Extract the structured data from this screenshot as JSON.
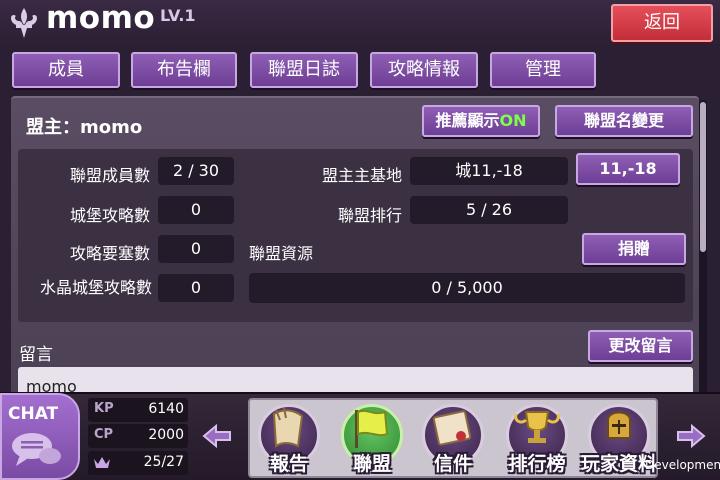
{
  "header": {
    "title": "momo",
    "level": "LV.1",
    "back_label": "返回"
  },
  "tabs": [
    {
      "label": "成員"
    },
    {
      "label": "布告欄"
    },
    {
      "label": "聯盟日誌"
    },
    {
      "label": "攻略情報"
    },
    {
      "label": "管理"
    }
  ],
  "panel": {
    "leader": "盟主：momo",
    "recommend_label": "推薦顯示",
    "recommend_state": "ON",
    "rename_label": "聯盟名變更",
    "members_label": "聯盟成員數",
    "members_value": "2 / 30",
    "castle_label": "城堡攻略數",
    "castle_value": "0",
    "fortress_label": "攻略要塞數",
    "fortress_value": "0",
    "crystal_label": "水晶城堡攻略數",
    "crystal_value": "0",
    "base_label": "盟主主基地",
    "base_value": "城11,-18",
    "base_coord_button": "11,-18",
    "rank_label": "聯盟排行",
    "rank_value": "5 / 26",
    "resource_label": "聯盟資源",
    "donate_label": "捐贈",
    "resource_value": "0 / 5,000",
    "message_label": "留言",
    "edit_message_label": "更改留言",
    "message_text": "momo"
  },
  "bottom": {
    "chat_label": "CHAT",
    "stats": [
      {
        "key": "KP",
        "value": "6140"
      },
      {
        "key": "CP",
        "value": "2000"
      },
      {
        "key": "crown-icon",
        "value": "25/27"
      }
    ],
    "nav": [
      {
        "label": "報告",
        "icon": "scroll-icon"
      },
      {
        "label": "聯盟",
        "icon": "flag-icon"
      },
      {
        "label": "信件",
        "icon": "letter-icon"
      },
      {
        "label": "排行榜",
        "icon": "trophy-icon"
      },
      {
        "label": "玩家資料",
        "icon": "knight-helmet-icon"
      }
    ],
    "watermark": "Development"
  },
  "colors": {
    "accent": "#7b4ba6",
    "back": "#d63a44",
    "on": "#7dff4a",
    "active_nav": "#3fa63f"
  }
}
